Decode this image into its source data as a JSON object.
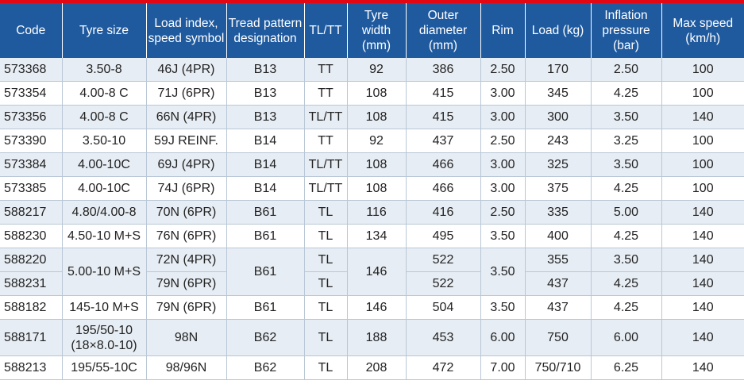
{
  "headers": [
    "Code",
    "Tyre size",
    "Load index, speed symbol",
    "Tread pattern designation",
    "TL/TT",
    "Tyre width (mm)",
    "Outer diameter (mm)",
    "Rim",
    "Load (kg)",
    "Inflation pressure (bar)",
    "Max speed (km/h)"
  ],
  "rows": [
    [
      "573368",
      "3.50-8",
      "46J (4PR)",
      "B13",
      "TT",
      "92",
      "386",
      "2.50",
      "170",
      "2.50",
      "100"
    ],
    [
      "573354",
      "4.00-8 C",
      "71J (6PR)",
      "B13",
      "TT",
      "108",
      "415",
      "3.00",
      "345",
      "4.25",
      "100"
    ],
    [
      "573356",
      "4.00-8 C",
      "66N (4PR)",
      "B13",
      "TL/TT",
      "108",
      "415",
      "3.00",
      "300",
      "3.50",
      "140"
    ],
    [
      "573390",
      "3.50-10",
      "59J REINF.",
      "B14",
      "TT",
      "92",
      "437",
      "2.50",
      "243",
      "3.25",
      "100"
    ],
    [
      "573384",
      "4.00-10C",
      "69J (4PR)",
      "B14",
      "TL/TT",
      "108",
      "466",
      "3.00",
      "325",
      "3.50",
      "100"
    ],
    [
      "573385",
      "4.00-10C",
      "74J (6PR)",
      "B14",
      "TL/TT",
      "108",
      "466",
      "3.00",
      "375",
      "4.25",
      "100"
    ],
    [
      "588217",
      "4.80/4.00-8",
      "70N (6PR)",
      "B61",
      "TL",
      "116",
      "416",
      "2.50",
      "335",
      "5.00",
      "140"
    ],
    [
      "588230",
      "4.50-10 M+S",
      "76N (6PR)",
      "B61",
      "TL",
      "134",
      "495",
      "3.50",
      "400",
      "4.25",
      "140"
    ],
    [
      "588220",
      "5.00-10 M+S",
      "72N (4PR)",
      "B61",
      "TL",
      "146",
      "522",
      "3.50",
      "355",
      "3.50",
      "140"
    ],
    [
      "588231",
      "",
      "79N (6PR)",
      "",
      "TL",
      "",
      "522",
      "",
      "437",
      "4.25",
      "140"
    ],
    [
      "588182",
      "145-10 M+S",
      "79N (6PR)",
      "B61",
      "TL",
      "146",
      "504",
      "3.50",
      "437",
      "4.25",
      "140"
    ],
    [
      "588171",
      "195/50-10 (18×8.0-10)",
      "98N",
      "B62",
      "TL",
      "188",
      "453",
      "6.00",
      "750",
      "6.00",
      "140"
    ],
    [
      "588213",
      "195/55-10C",
      "98/96N",
      "B62",
      "TL",
      "208",
      "472",
      "7.00",
      "750/710",
      "6.25",
      "140"
    ]
  ]
}
